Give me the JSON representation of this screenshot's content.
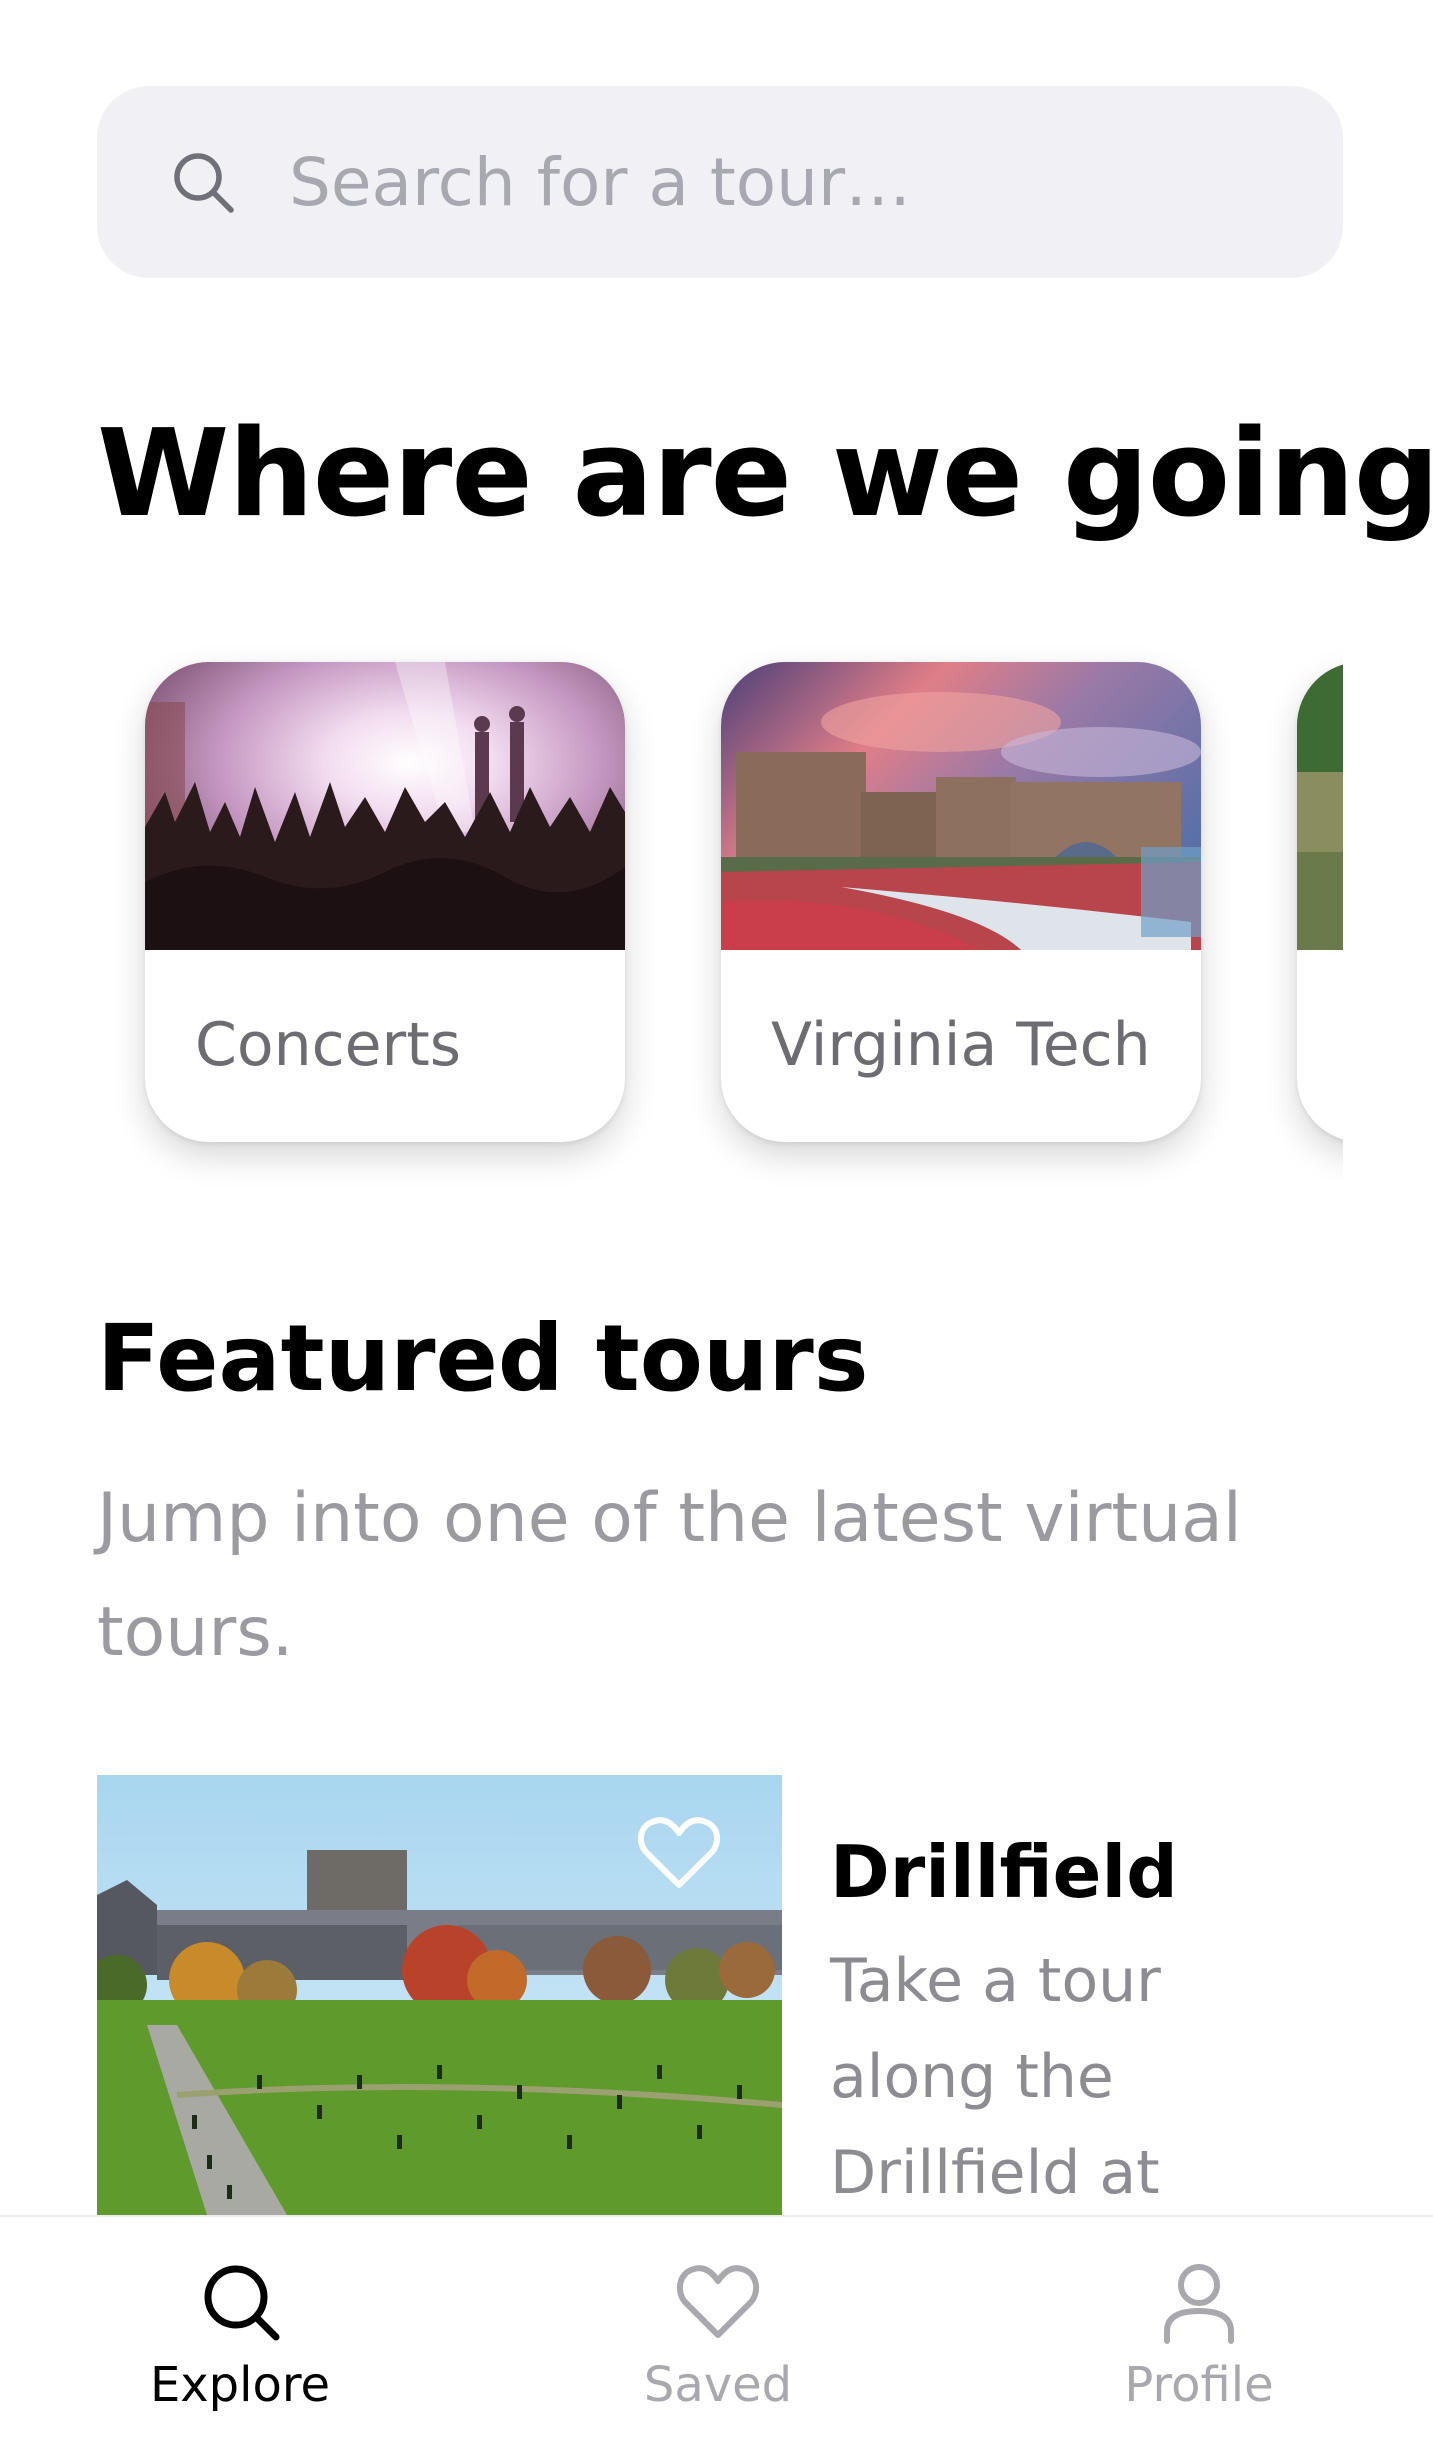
{
  "search": {
    "placeholder": "Search for a tour…",
    "icon": "search-icon"
  },
  "main": {
    "heading": "Where are we going?",
    "categories": [
      {
        "label": "Concerts",
        "image": "concert-crowd-photo"
      },
      {
        "label": "Virginia Tech",
        "image": "campus-building-photo"
      },
      {
        "label": "",
        "image": "nature-photo"
      }
    ],
    "featured": {
      "heading": "Featured tours",
      "subheading": "Jump into one of the latest virtual tours.",
      "tours": [
        {
          "title": "Drillfield",
          "description": "Take a tour along the Drillfield at",
          "image": "drillfield-photo",
          "save_icon": "heart-outline-icon"
        }
      ]
    }
  },
  "tabbar": {
    "items": [
      {
        "label": "Explore",
        "icon": "search-icon",
        "active": true
      },
      {
        "label": "Saved",
        "icon": "heart-icon",
        "active": false
      },
      {
        "label": "Profile",
        "icon": "person-icon",
        "active": false
      }
    ],
    "active_color": "#000000",
    "inactive_color": "#a8a8ae"
  }
}
